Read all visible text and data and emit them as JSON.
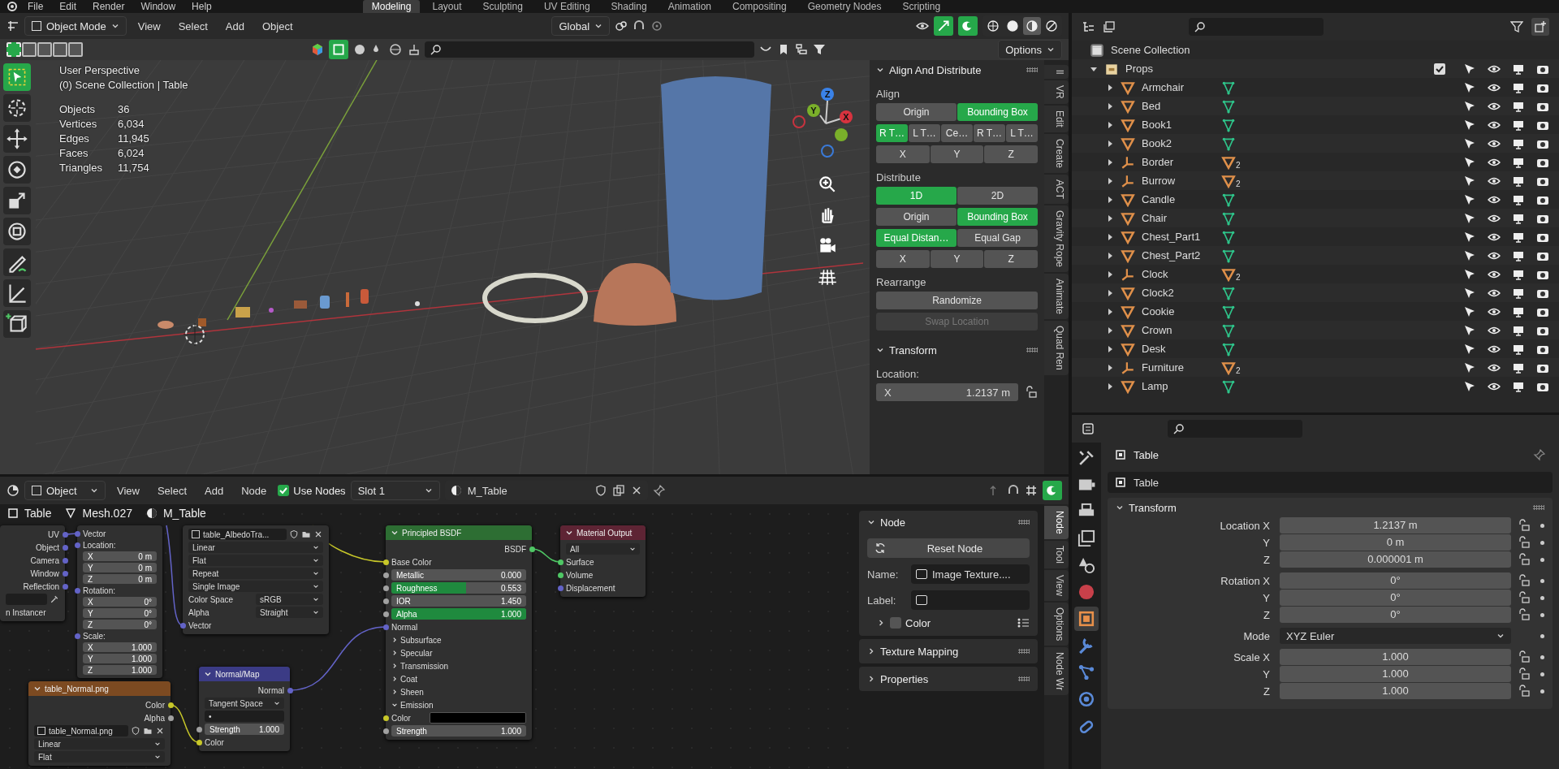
{
  "top_menu": [
    "File",
    "Edit",
    "Render",
    "Window",
    "Help"
  ],
  "workspaces": [
    {
      "label": "Modeling",
      "selected": true
    },
    {
      "label": "Layout",
      "selected": false
    },
    {
      "label": "Sculpting",
      "selected": false
    },
    {
      "label": "UV Editing",
      "selected": false
    },
    {
      "label": "Shading",
      "selected": false
    },
    {
      "label": "Animation",
      "selected": false
    },
    {
      "label": "Compositing",
      "selected": false
    },
    {
      "label": "Geometry Nodes",
      "selected": false
    },
    {
      "label": "Scripting",
      "selected": false
    }
  ],
  "viewport": {
    "mode": "Object Mode",
    "menus": [
      "View",
      "Select",
      "Add",
      "Object"
    ],
    "orientation": "Global",
    "options": "Options",
    "select_modes": [
      {
        "selected": true
      },
      {
        "selected": false
      },
      {
        "selected": false
      },
      {
        "selected": false
      },
      {
        "selected": false
      }
    ],
    "shading": [
      {
        "kind": "wireframe",
        "selected": false
      },
      {
        "kind": "solid",
        "selected": false
      },
      {
        "kind": "material",
        "selected": true
      },
      {
        "kind": "rendered",
        "selected": false
      }
    ],
    "tools": [
      {
        "kind": "select",
        "selected": true
      },
      {
        "kind": "cursor",
        "selected": false
      },
      {
        "kind": "move",
        "selected": false
      },
      {
        "kind": "rotate",
        "selected": false
      },
      {
        "kind": "scale",
        "selected": false
      },
      {
        "kind": "transform",
        "selected": false
      },
      {
        "kind": "annotate",
        "selected": false
      },
      {
        "kind": "measure",
        "selected": false
      },
      {
        "kind": "add_cube",
        "selected": false
      }
    ],
    "view_name": "User Perspective",
    "context": "(0) Scene Collection | Table",
    "stats": [
      {
        "label": "Objects",
        "value": "36"
      },
      {
        "label": "Vertices",
        "value": "6,034"
      },
      {
        "label": "Edges",
        "value": "11,945"
      },
      {
        "label": "Faces",
        "value": "6,024"
      },
      {
        "label": "Triangles",
        "value": "11,754"
      }
    ],
    "gizmo": {
      "x": "X",
      "y": "Y",
      "z": "Z"
    },
    "sidebar": {
      "title": "Align And Distribute",
      "sections": [
        {
          "label": "Align",
          "rows": [
            {
              "buttons": [
                {
                  "label": "Origin",
                  "selected": false
                },
                {
                  "label": "Bounding Box",
                  "selected": true
                }
              ]
            },
            {
              "buttons": [
                {
                  "label": "R T…",
                  "selected": true
                },
                {
                  "label": "L T…",
                  "selected": false
                },
                {
                  "label": "Ce…",
                  "selected": false
                },
                {
                  "label": "R T…",
                  "selected": false
                },
                {
                  "label": "L T…",
                  "selected": false
                }
              ]
            },
            {
              "buttons": [
                {
                  "label": "X",
                  "selected": false
                },
                {
                  "label": "Y",
                  "selected": false
                },
                {
                  "label": "Z",
                  "selected": false
                }
              ]
            }
          ]
        },
        {
          "label": "Distribute",
          "rows": [
            {
              "buttons": [
                {
                  "label": "1D",
                  "selected": true
                },
                {
                  "label": "2D",
                  "selected": false
                }
              ]
            },
            {
              "buttons": [
                {
                  "label": "Origin",
                  "selected": false
                },
                {
                  "label": "Bounding Box",
                  "selected": true
                }
              ]
            },
            {
              "buttons": [
                {
                  "label": "Equal Distan…",
                  "selected": true
                },
                {
                  "label": "Equal Gap",
                  "selected": false
                }
              ]
            },
            {
              "buttons": [
                {
                  "label": "X",
                  "selected": false
                },
                {
                  "label": "Y",
                  "selected": false
                },
                {
                  "label": "Z",
                  "selected": false
                }
              ]
            }
          ]
        },
        {
          "label": "Rearrange",
          "rows": [
            {
              "buttons": [
                {
                  "label": "Randomize",
                  "disabled": false
                }
              ]
            },
            {
              "buttons": [
                {
                  "label": "Swap Location",
                  "disabled": true
                }
              ]
            }
          ]
        }
      ],
      "transform": {
        "title": "Transform",
        "location_label": "Location:",
        "axis": "X",
        "value": "1.2137 m"
      }
    },
    "sidebar_tabs": [
      "ll",
      "VR",
      "Edit",
      "Create",
      "ACT",
      "Gravity Rope",
      "Animate",
      "Quad Ren"
    ]
  },
  "outliner": {
    "root": "Scene Collection",
    "collections": [
      {
        "name": "Props",
        "expanded": true,
        "checked": true,
        "children": [
          {
            "name": "Armchair",
            "kind": "mesh",
            "expanded": false
          },
          {
            "name": "Bed",
            "kind": "mesh",
            "expanded": false
          },
          {
            "name": "Book1",
            "kind": "mesh",
            "expanded": false
          },
          {
            "name": "Book2",
            "kind": "mesh",
            "expanded": false
          },
          {
            "name": "Border",
            "kind": "empty",
            "count": "2",
            "expanded": false
          },
          {
            "name": "Burrow",
            "kind": "empty",
            "count": "2",
            "expanded": false
          },
          {
            "name": "Candle",
            "kind": "mesh",
            "expanded": false
          },
          {
            "name": "Chair",
            "kind": "mesh",
            "expanded": false
          },
          {
            "name": "Chest_Part1",
            "kind": "mesh",
            "expanded": false
          },
          {
            "name": "Chest_Part2",
            "kind": "mesh",
            "expanded": false
          },
          {
            "name": "Clock",
            "kind": "empty",
            "count": "2",
            "expanded": false
          },
          {
            "name": "Clock2",
            "kind": "mesh",
            "expanded": false
          },
          {
            "name": "Cookie",
            "kind": "mesh",
            "expanded": false
          },
          {
            "name": "Crown",
            "kind": "mesh",
            "expanded": false
          },
          {
            "name": "Desk",
            "kind": "mesh",
            "expanded": false
          },
          {
            "name": "Furniture",
            "kind": "empty",
            "count": "2",
            "expanded": false
          },
          {
            "name": "Lamp",
            "kind": "mesh",
            "expanded": false
          }
        ]
      }
    ]
  },
  "node_editor": {
    "mode": "Object",
    "menus": [
      "View",
      "Select",
      "Add",
      "Node"
    ],
    "use_nodes": {
      "label": "Use Nodes",
      "checked": true
    },
    "slot": "Slot 1",
    "material": "M_Table",
    "breadcrumbs": [
      "Table",
      "Mesh.027",
      "M_Table"
    ],
    "nodes": [
      {
        "kind": "input",
        "rows": [
          {
            "kind": "out",
            "label": "UV",
            "socket": {
              "color": "#6363c7"
            }
          },
          {
            "kind": "out",
            "label": "Object",
            "socket": {
              "color": "#6363c7"
            }
          },
          {
            "kind": "out",
            "label": "Camera",
            "socket": {
              "color": "#6363c7"
            }
          },
          {
            "kind": "out",
            "label": "Window",
            "socket": {
              "color": "#6363c7"
            }
          },
          {
            "kind": "out",
            "label": "Reflection",
            "socket": {
              "color": "#6363c7"
            }
          },
          {
            "kind": "picker"
          },
          {
            "kind": "label",
            "label": "n Instancer"
          }
        ]
      },
      {
        "kind": "mapping",
        "rows": [
          {
            "kind": "in",
            "label": "Vector",
            "socket": {
              "color": "#6363c7"
            }
          },
          {
            "kind": "in",
            "label": "Location:",
            "socket": {
              "color": "#6363c7"
            }
          },
          {
            "kind": "value",
            "label": "X",
            "value": "0 m"
          },
          {
            "kind": "value",
            "label": "Y",
            "value": "0 m"
          },
          {
            "kind": "value",
            "label": "Z",
            "value": "0 m"
          },
          {
            "kind": "in",
            "label": "Rotation:",
            "socket": {
              "color": "#6363c7"
            }
          },
          {
            "kind": "value",
            "label": "X",
            "value": "0°"
          },
          {
            "kind": "value",
            "label": "Y",
            "value": "0°"
          },
          {
            "kind": "value",
            "label": "Z",
            "value": "0°"
          },
          {
            "kind": "in",
            "label": "Scale:",
            "socket": {
              "color": "#6363c7"
            }
          },
          {
            "kind": "value",
            "label": "X",
            "value": "1.000"
          },
          {
            "kind": "value",
            "label": "Y",
            "value": "1.000"
          },
          {
            "kind": "value",
            "label": "Z",
            "value": "1.000"
          }
        ]
      },
      {
        "kind": "texture",
        "rows": [
          {
            "kind": "image",
            "value": "table_AlbedoTra..."
          },
          {
            "kind": "dropdown",
            "value": "Linear"
          },
          {
            "kind": "dropdown",
            "value": "Flat"
          },
          {
            "kind": "dropdown",
            "value": "Repeat"
          },
          {
            "kind": "dropdown",
            "value": "Single Image"
          },
          {
            "kind": "dropdown",
            "label": "Color Space",
            "value": "sRGB"
          },
          {
            "kind": "dropdown",
            "label": "Alpha",
            "value": "Straight"
          },
          {
            "kind": "in",
            "label": "Vector",
            "socket": {
              "color": "#6363c7"
            }
          }
        ]
      },
      {
        "kind": "shader",
        "title": "Principled BSDF",
        "rows": [
          {
            "kind": "out",
            "label": "BSDF",
            "socket": {
              "color": "#4fc765"
            }
          },
          {
            "kind": "in",
            "label": "Base Color",
            "socket": {
              "color": "#c7c729"
            }
          },
          {
            "kind": "value",
            "label": "Metallic",
            "value": "0.000",
            "socket": {
              "color": "#a1a1a1"
            }
          },
          {
            "kind": "value",
            "label": "Roughness",
            "value": "0.553",
            "socket": {
              "color": "#a1a1a1"
            },
            "level": 0.553
          },
          {
            "kind": "value",
            "label": "IOR",
            "value": "1.450",
            "socket": {
              "color": "#a1a1a1"
            }
          },
          {
            "kind": "value",
            "label": "Alpha",
            "value": "1.000",
            "socket": {
              "color": "#a1a1a1"
            },
            "level": 1
          },
          {
            "kind": "in",
            "label": "Normal",
            "socket": {
              "color": "#6363c7"
            }
          },
          {
            "kind": "panel",
            "label": "Subsurface",
            "expanded": false
          },
          {
            "kind": "panel",
            "label": "Specular",
            "expanded": false
          },
          {
            "kind": "panel",
            "label": "Transmission",
            "expanded": false
          },
          {
            "kind": "panel",
            "label": "Coat",
            "expanded": false
          },
          {
            "kind": "panel",
            "label": "Sheen",
            "expanded": false
          },
          {
            "kind": "panel",
            "label": "Emission",
            "expanded": true
          },
          {
            "kind": "color",
            "label": "Color",
            "socket": {
              "color": "#c7c729"
            },
            "color": "#000000"
          },
          {
            "kind": "value",
            "label": "Strength",
            "value": "1.000",
            "socket": {
              "color": "#a1a1a1"
            }
          }
        ]
      },
      {
        "kind": "output",
        "title": "Material Output",
        "rows": [
          {
            "kind": "dropdown",
            "value": "All"
          },
          {
            "kind": "in",
            "label": "Surface",
            "socket": {
              "color": "#4fc765"
            }
          },
          {
            "kind": "in",
            "label": "Volume",
            "socket": {
              "color": "#4fc765"
            }
          },
          {
            "kind": "in",
            "label": "Displacement",
            "socket": {
              "color": "#6363c7"
            }
          }
        ]
      },
      {
        "kind": "vector",
        "title": "Normal/Map",
        "rows": [
          {
            "kind": "out",
            "label": "Normal",
            "socket": {
              "color": "#6363c7"
            }
          },
          {
            "kind": "dropdown",
            "value": "Tangent Space"
          },
          {
            "kind": "field",
            "value": "•"
          },
          {
            "kind": "value",
            "label": "Strength",
            "value": "1.000",
            "socket": {
              "color": "#a1a1a1"
            }
          },
          {
            "kind": "in",
            "label": "Color",
            "socket": {
              "color": "#c7c729"
            }
          }
        ]
      },
      {
        "kind": "texture",
        "title": "table_Normal.png",
        "rows": [
          {
            "kind": "out",
            "label": "Color",
            "socket": {
              "color": "#c7c729"
            }
          },
          {
            "kind": "out",
            "label": "Alpha",
            "socket": {
              "color": "#a1a1a1"
            }
          },
          {
            "kind": "image",
            "value": "table_Normal.png"
          },
          {
            "kind": "dropdown",
            "value": "Linear"
          },
          {
            "kind": "dropdown",
            "value": "Flat"
          }
        ]
      }
    ],
    "sidebar": {
      "panel": "Node",
      "reset": "Reset Node",
      "name_label": "Name:",
      "name": "Image Texture....",
      "label_label": "Label:",
      "color": {
        "label": "Color",
        "checked": false
      },
      "panels": [
        "Texture Mapping",
        "Properties"
      ]
    },
    "tabs": [
      {
        "label": "Node",
        "selected": true
      },
      {
        "label": "Tool",
        "selected": false
      },
      {
        "label": "View",
        "selected": false
      },
      {
        "label": "Options",
        "selected": false
      },
      {
        "label": "Node Wr",
        "selected": false
      }
    ]
  },
  "properties": {
    "tabs": [
      {
        "kind": "tool",
        "selected": false
      },
      {
        "kind": "render",
        "selected": false
      },
      {
        "kind": "output",
        "selected": false
      },
      {
        "kind": "view_layer",
        "selected": false
      },
      {
        "kind": "scene",
        "selected": false
      },
      {
        "kind": "world",
        "selected": false
      },
      {
        "kind": "object",
        "selected": true
      },
      {
        "kind": "modifier",
        "selected": false
      },
      {
        "kind": "particles",
        "selected": false
      },
      {
        "kind": "physics",
        "selected": false
      },
      {
        "kind": "constraints",
        "selected": false
      }
    ],
    "title": "Table",
    "object_name": "Table",
    "panel": "Transform",
    "groups": [
      {
        "rows": [
          {
            "label": "Location X",
            "value": "1.2137 m",
            "kind": "number"
          },
          {
            "label": "Y",
            "value": "0 m",
            "kind": "number"
          },
          {
            "label": "Z",
            "value": "0.000001 m",
            "kind": "number"
          }
        ]
      },
      {
        "rows": [
          {
            "label": "Rotation X",
            "value": "0°",
            "kind": "number"
          },
          {
            "label": "Y",
            "value": "0°",
            "kind": "number"
          },
          {
            "label": "Z",
            "value": "0°",
            "kind": "number"
          }
        ]
      },
      {
        "rows": [
          {
            "label": "Mode",
            "value": "XYZ Euler",
            "kind": "dropdown"
          }
        ]
      },
      {
        "rows": [
          {
            "label": "Scale X",
            "value": "1.000",
            "kind": "number"
          },
          {
            "label": "Y",
            "value": "1.000",
            "kind": "number"
          },
          {
            "label": "Z",
            "value": "1.000",
            "kind": "number"
          }
        ]
      }
    ]
  }
}
